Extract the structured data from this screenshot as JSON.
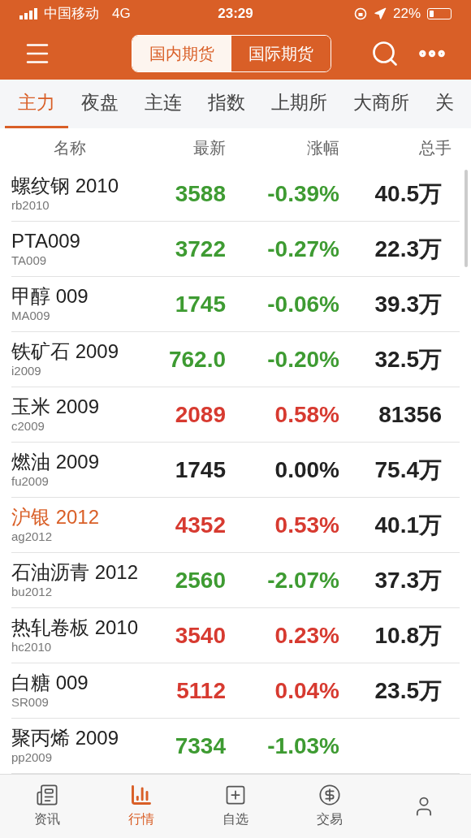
{
  "status_bar": {
    "carrier": "中国移动",
    "network": "4G",
    "time": "23:29",
    "battery": "22%"
  },
  "header": {
    "segments": [
      {
        "label": "国内期货",
        "selected": true
      },
      {
        "label": "国际期货",
        "selected": false
      }
    ]
  },
  "tabs": [
    {
      "label": "主力",
      "selected": true
    },
    {
      "label": "夜盘",
      "selected": false
    },
    {
      "label": "主连",
      "selected": false
    },
    {
      "label": "指数",
      "selected": false
    },
    {
      "label": "上期所",
      "selected": false
    },
    {
      "label": "大商所",
      "selected": false
    },
    {
      "label": "关",
      "selected": false
    }
  ],
  "table": {
    "columns": [
      "名称",
      "最新",
      "涨幅",
      "总手"
    ],
    "rows": [
      {
        "name": "螺纹钢 2010",
        "code": "rb2010",
        "price": "3588",
        "change": "-0.39%",
        "volume": "40.5万",
        "color": "#3e9b32",
        "highlighted": false
      },
      {
        "name": "PTA009",
        "code": "TA009",
        "price": "3722",
        "change": "-0.27%",
        "volume": "22.3万",
        "color": "#3e9b32",
        "highlighted": false
      },
      {
        "name": "甲醇 009",
        "code": "MA009",
        "price": "1745",
        "change": "-0.06%",
        "volume": "39.3万",
        "color": "#3e9b32",
        "highlighted": false
      },
      {
        "name": "铁矿石 2009",
        "code": "i2009",
        "price": "762.0",
        "change": "-0.20%",
        "volume": "32.5万",
        "color": "#3e9b32",
        "highlighted": false
      },
      {
        "name": "玉米 2009",
        "code": "c2009",
        "price": "2089",
        "change": "0.58%",
        "volume": "81356",
        "color": "#d73a30",
        "highlighted": false
      },
      {
        "name": "燃油 2009",
        "code": "fu2009",
        "price": "1745",
        "change": "0.00%",
        "volume": "75.4万",
        "color": "#222222",
        "highlighted": false
      },
      {
        "name": "沪银 2012",
        "code": "ag2012",
        "price": "4352",
        "change": "0.53%",
        "volume": "40.1万",
        "color": "#d73a30",
        "highlighted": true
      },
      {
        "name": "石油沥青 2012",
        "code": "bu2012",
        "price": "2560",
        "change": "-2.07%",
        "volume": "37.3万",
        "color": "#3e9b32",
        "highlighted": false
      },
      {
        "name": "热轧卷板 2010",
        "code": "hc2010",
        "price": "3540",
        "change": "0.23%",
        "volume": "10.8万",
        "color": "#d73a30",
        "highlighted": false
      },
      {
        "name": "白糖 009",
        "code": "SR009",
        "price": "5112",
        "change": "0.04%",
        "volume": "23.5万",
        "color": "#d73a30",
        "highlighted": false
      },
      {
        "name": "聚丙烯 2009",
        "code": "pp2009",
        "price": "7334",
        "change": "-1.03%",
        "color": "#3e9b32",
        "highlighted": false
      }
    ]
  },
  "bottom_nav": [
    {
      "label": "资讯",
      "kind": "news",
      "selected": false
    },
    {
      "label": "行情",
      "kind": "market",
      "selected": true
    },
    {
      "label": "自选",
      "kind": "watchlist",
      "selected": false
    },
    {
      "label": "交易",
      "kind": "trade",
      "selected": false
    },
    {
      "kind": "profile",
      "selected": false
    }
  ]
}
